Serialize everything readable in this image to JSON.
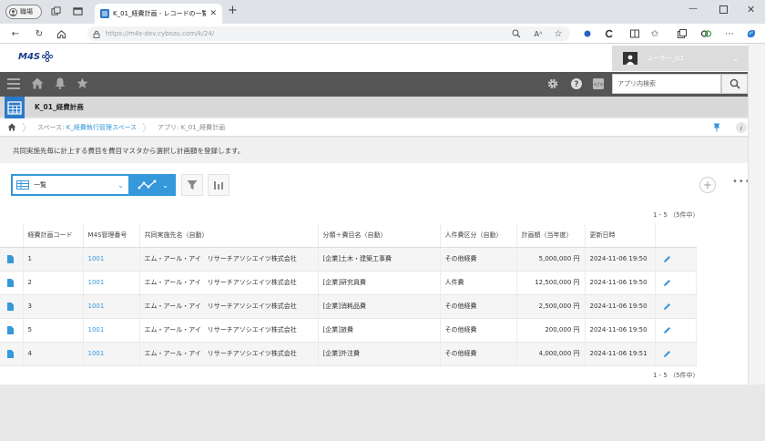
{
  "browser": {
    "profile_label": "職場",
    "tab_title": "K_01_経費計画 - レコードの一覧",
    "url": "https://m4s-dev.cybozu.com/k/24/"
  },
  "header": {
    "logo": "M4S",
    "user_name": "ユーザー_U1"
  },
  "search": {
    "placeholder": "アプリ内検索"
  },
  "app": {
    "name": "K_01_経費計画"
  },
  "breadcrumb": {
    "space_prefix": "スペース: ",
    "space_link": "K_経費執行管理スペース",
    "app_label": "アプリ: K_01_経費計画"
  },
  "description": "共同実施先毎に計上する費目を費目マスタから選択し計画額を登録します。",
  "view": {
    "selected": "一覧"
  },
  "pagination": {
    "top": "1 - 5 （5件中）",
    "bottom": "1 - 5 （5件中）"
  },
  "table": {
    "columns": [
      "",
      "経費計画コード",
      "M4S管理番号",
      "共同実施先名（自動）",
      "分類＋費目名（自動）",
      "人件費区分（自動）",
      "計画額（当年度）",
      "更新日時",
      ""
    ],
    "rows": [
      {
        "code": "1",
        "m4s": "1001",
        "partner": "エム・アール・アイ　リサーチアソシエイツ株式会社",
        "category": "[企業]土木・建築工事費",
        "labor": "その他経費",
        "amount": "5,000,000 円",
        "updated": "2024-11-06 19:50"
      },
      {
        "code": "2",
        "m4s": "1001",
        "partner": "エム・アール・アイ　リサーチアソシエイツ株式会社",
        "category": "[企業]研究員費",
        "labor": "人件費",
        "amount": "12,500,000 円",
        "updated": "2024-11-06 19:50"
      },
      {
        "code": "3",
        "m4s": "1001",
        "partner": "エム・アール・アイ　リサーチアソシエイツ株式会社",
        "category": "[企業]消耗品費",
        "labor": "その他経費",
        "amount": "2,500,000 円",
        "updated": "2024-11-06 19:50"
      },
      {
        "code": "5",
        "m4s": "1001",
        "partner": "エム・アール・アイ　リサーチアソシエイツ株式会社",
        "category": "[企業]旅費",
        "labor": "その他経費",
        "amount": "200,000 円",
        "updated": "2024-11-06 19:50"
      },
      {
        "code": "4",
        "m4s": "1001",
        "partner": "エム・アール・アイ　リサーチアソシエイツ株式会社",
        "category": "[企業]外注費",
        "labor": "その他経費",
        "amount": "4,000,000 円",
        "updated": "2024-11-06 19:51"
      }
    ]
  },
  "colors": {
    "accent": "#3498db",
    "navbar": "#555555",
    "app_icon": "#2b7ac8"
  }
}
